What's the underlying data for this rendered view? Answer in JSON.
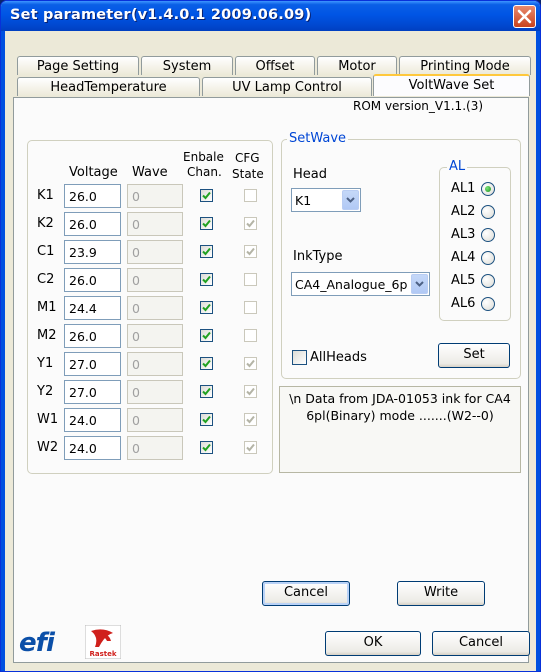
{
  "window": {
    "title": "Set parameter(v1.4.0.1 2009.06.09)"
  },
  "tabs": {
    "row1": [
      "Page Setting",
      "System",
      "Offset",
      "Motor",
      "Printing Mode"
    ],
    "row2": [
      "HeadTemperature",
      "UV Lamp Control",
      "VoltWave Set"
    ],
    "active": "VoltWave Set"
  },
  "rom_version": "ROM version_V1.1.(3)",
  "table": {
    "headers": {
      "voltage": "Voltage",
      "wave": "Wave",
      "enable_line1": "Enbale",
      "enable_line2": "Chan.",
      "cfg_line1": "CFG",
      "cfg_line2": "State"
    },
    "rows": [
      {
        "label": "K1",
        "voltage": "26.0",
        "wave": "0",
        "enabled": true,
        "cfg": false
      },
      {
        "label": "K2",
        "voltage": "26.0",
        "wave": "0",
        "enabled": true,
        "cfg": true
      },
      {
        "label": "C1",
        "voltage": "23.9",
        "wave": "0",
        "enabled": true,
        "cfg": true
      },
      {
        "label": "C2",
        "voltage": "26.0",
        "wave": "0",
        "enabled": true,
        "cfg": false
      },
      {
        "label": "M1",
        "voltage": "24.4",
        "wave": "0",
        "enabled": true,
        "cfg": false
      },
      {
        "label": "M2",
        "voltage": "26.0",
        "wave": "0",
        "enabled": true,
        "cfg": false
      },
      {
        "label": "Y1",
        "voltage": "27.0",
        "wave": "0",
        "enabled": true,
        "cfg": true
      },
      {
        "label": "Y2",
        "voltage": "27.0",
        "wave": "0",
        "enabled": true,
        "cfg": true
      },
      {
        "label": "W1",
        "voltage": "24.0",
        "wave": "0",
        "enabled": true,
        "cfg": true
      },
      {
        "label": "W2",
        "voltage": "24.0",
        "wave": "0",
        "enabled": true,
        "cfg": true
      }
    ]
  },
  "setwave": {
    "group_title": "SetWave",
    "head_label": "Head",
    "head_value": "K1",
    "inktype_label": "InkType",
    "inktype_value": "CA4_Analogue_6p",
    "al_group_title": "AL",
    "al_options": [
      "AL1",
      "AL2",
      "AL3",
      "AL4",
      "AL5",
      "AL6"
    ],
    "al_selected": "AL1",
    "allheads_label": "AllHeads",
    "allheads_checked": false,
    "set_button": "Set"
  },
  "message": {
    "line1": "\\n Data from JDA-01053 ink for CA4",
    "line2": "6pl(Binary) mode .......(W2--0)"
  },
  "buttons": {
    "cancel_inner": "Cancel",
    "write": "Write",
    "ok": "OK",
    "cancel": "Cancel"
  },
  "logos": {
    "efi": "efi",
    "rastek": "Rastek"
  },
  "colors": {
    "title_bar": "#0055e5",
    "check_green": "#21a121",
    "close_red": "#c9421c"
  }
}
